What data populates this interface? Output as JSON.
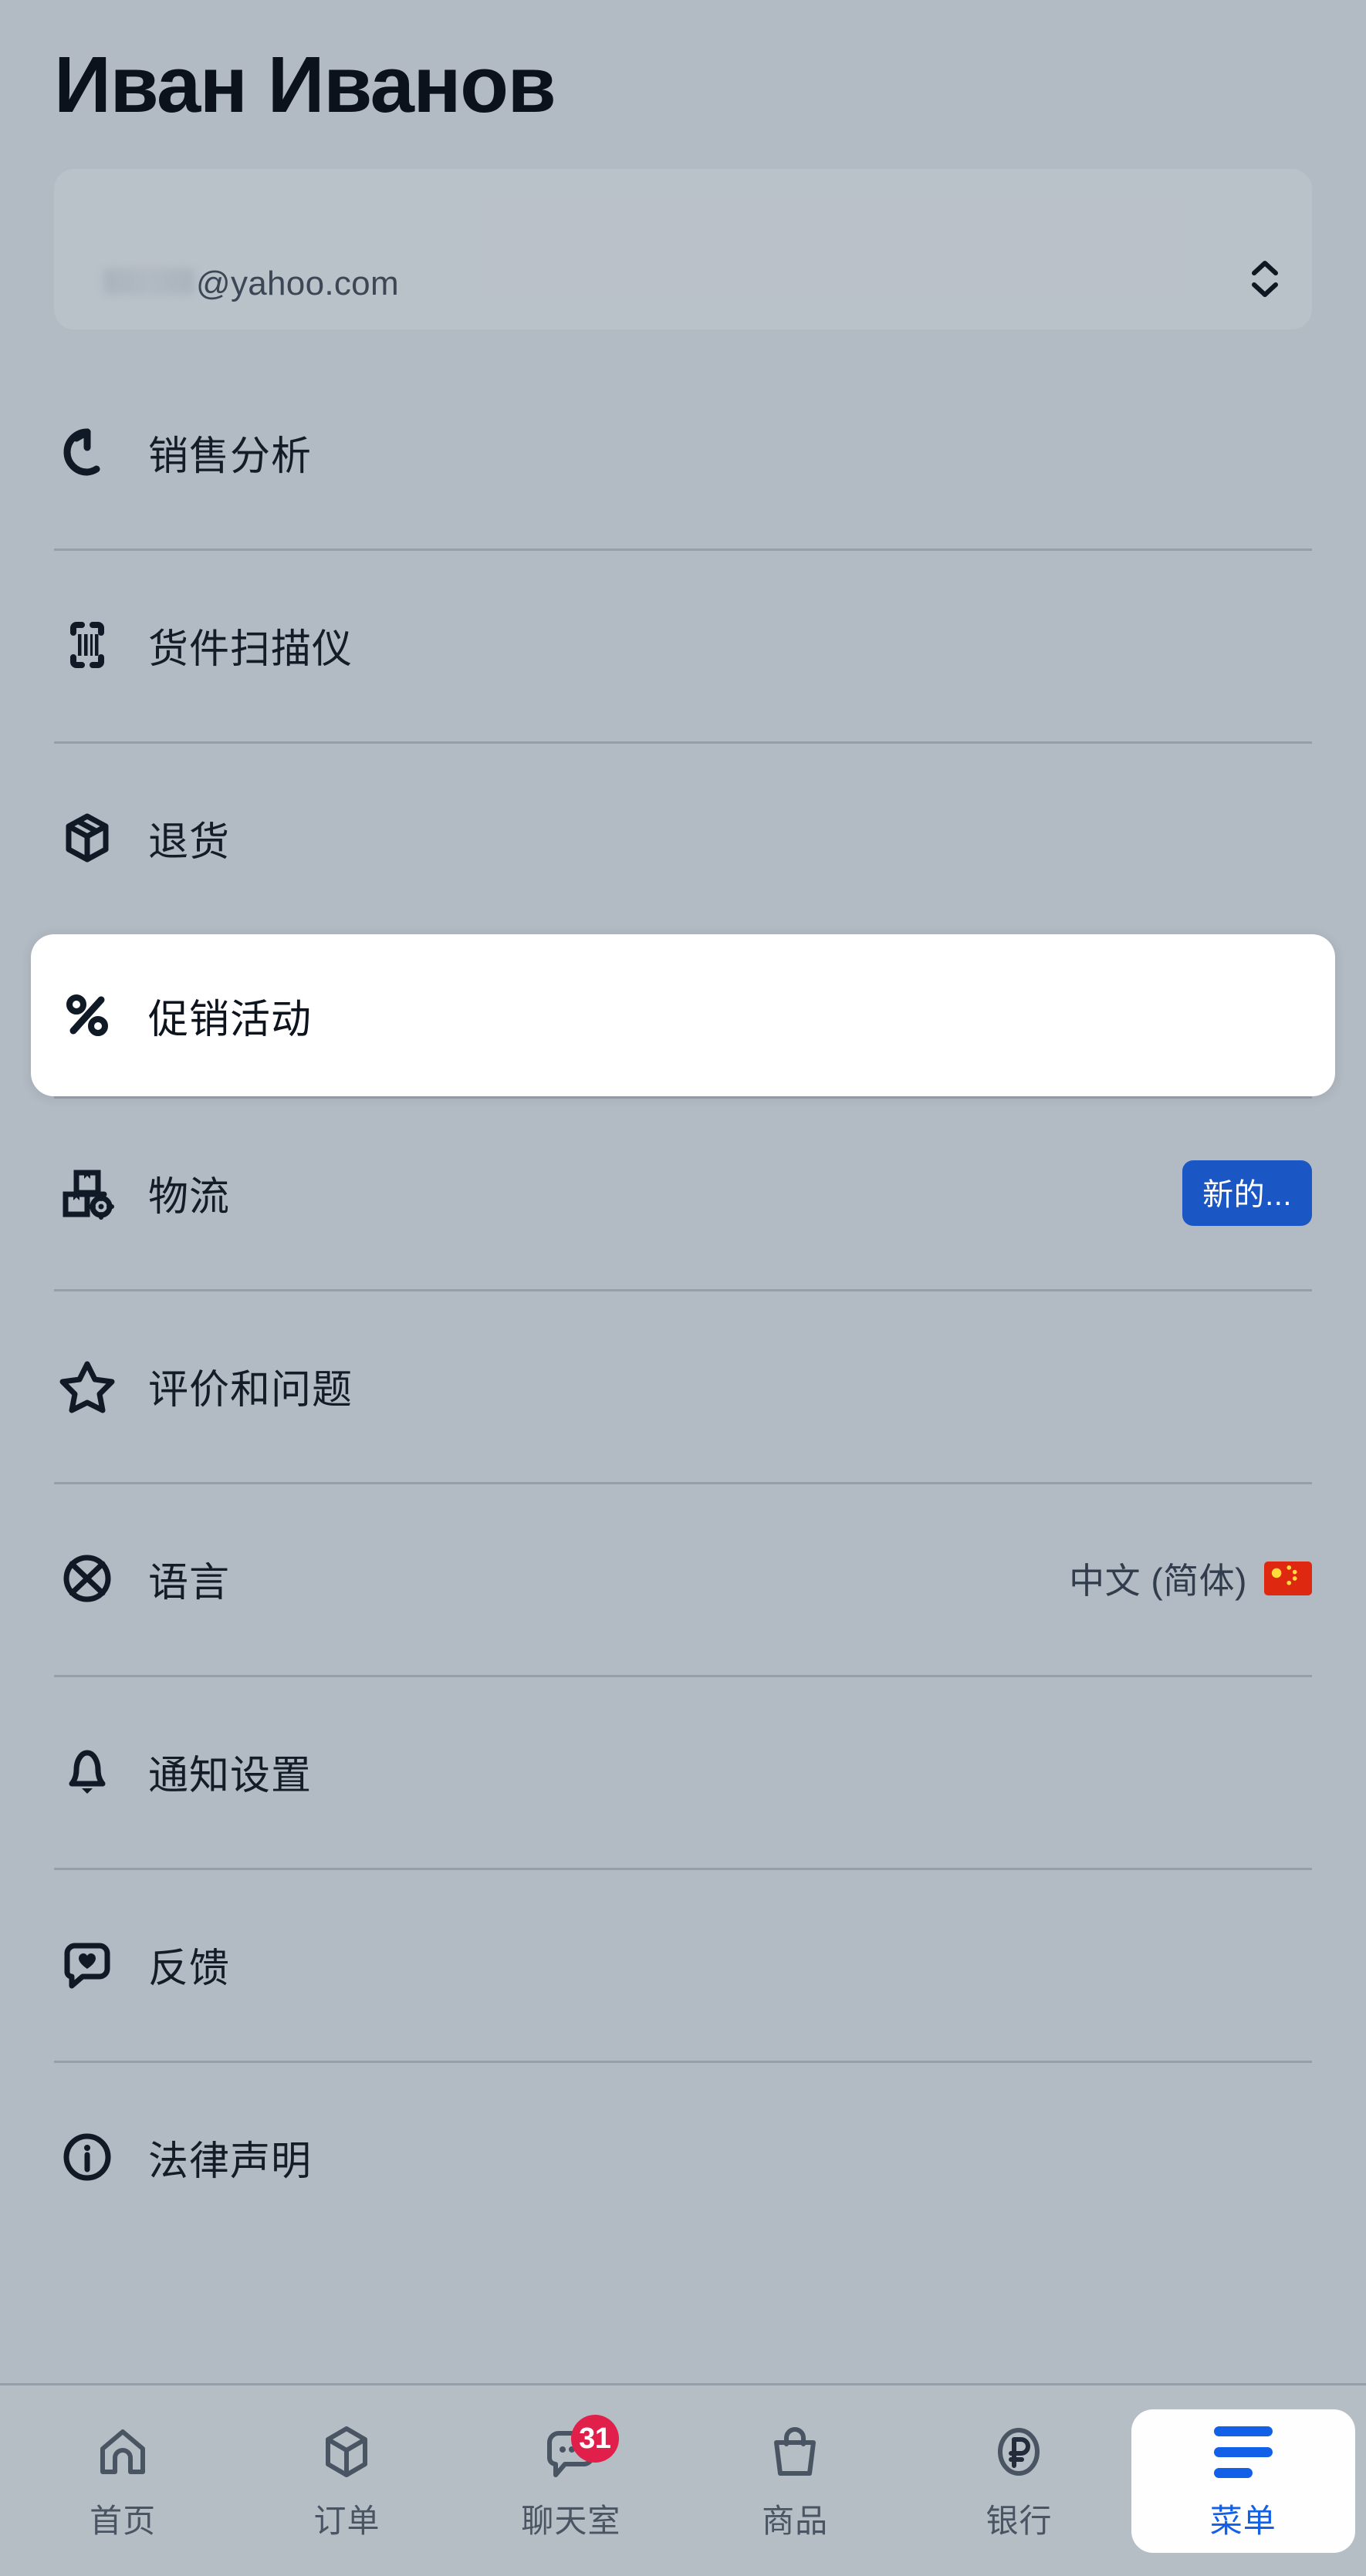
{
  "header": {
    "profile_name": "Иван Иванов"
  },
  "account_selector": {
    "email_domain": "@yahoo.com",
    "username_masked": "",
    "chevron_icon": "chevron-up-down-icon"
  },
  "menu": {
    "items": [
      {
        "icon": "sales-analytics-icon",
        "label": "销售分析",
        "value": "",
        "badge": ""
      },
      {
        "icon": "barcode-scanner-icon",
        "label": "货件扫描仪",
        "value": "",
        "badge": ""
      },
      {
        "icon": "package-return-icon",
        "label": "退货",
        "value": "",
        "badge": ""
      },
      {
        "icon": "percent-icon",
        "label": "促销活动",
        "value": "",
        "badge": "",
        "selected": true
      },
      {
        "icon": "logistics-boxes-gear-icon",
        "label": "物流",
        "value": "",
        "badge": "新的..."
      },
      {
        "icon": "star-icon",
        "label": "评价和问题",
        "value": "",
        "badge": ""
      },
      {
        "icon": "globe-language-icon",
        "label": "语言",
        "value": "中文 (简体)",
        "flag": "cn-flag-icon",
        "badge": ""
      },
      {
        "icon": "bell-icon",
        "label": "通知设置",
        "value": "",
        "badge": ""
      },
      {
        "icon": "heart-chat-icon",
        "label": "反馈",
        "value": "",
        "badge": ""
      },
      {
        "icon": "info-circle-icon",
        "label": "法律声明",
        "value": "",
        "badge": ""
      }
    ]
  },
  "bottom_nav": {
    "items": [
      {
        "icon": "home-icon",
        "label": "首页",
        "badge": "",
        "active": false
      },
      {
        "icon": "box-icon",
        "label": "订单",
        "badge": "",
        "active": false
      },
      {
        "icon": "chat-icon",
        "label": "聊天室",
        "badge": "31",
        "active": false
      },
      {
        "icon": "bag-icon",
        "label": "商品",
        "badge": "",
        "active": false
      },
      {
        "icon": "ruble-icon",
        "label": "银行",
        "badge": "",
        "active": false
      },
      {
        "icon": "menu-icon",
        "label": "菜单",
        "badge": "",
        "active": true
      }
    ]
  },
  "colors": {
    "background": "#b2bac3",
    "text_primary": "#141c28",
    "accent_blue": "#1260e8",
    "badge_blue": "#1a56c4",
    "badge_red": "#e01f4a",
    "card_white": "#ffffff"
  }
}
